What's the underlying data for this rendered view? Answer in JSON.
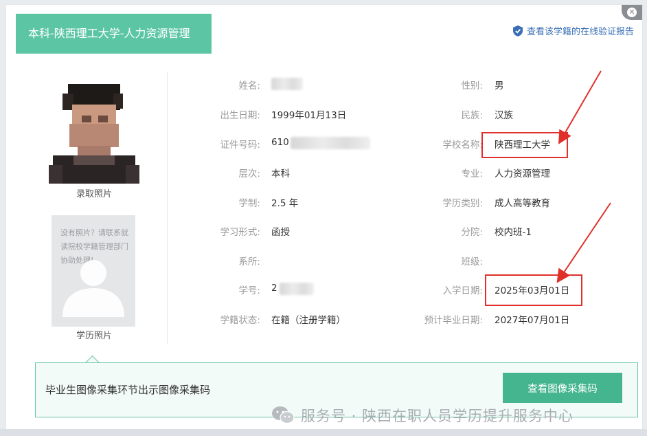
{
  "header": {
    "title": "本科-陕西理工大学-人力资源管理",
    "verify_link": "查看该学籍的在线验证报告"
  },
  "photos": {
    "enroll_label": "录取照片",
    "xueli_label": "学历照片",
    "xueli_placeholder_note": "没有照片？请联系就读院校学籍管理部门协助处理!"
  },
  "fields_left": [
    {
      "label": "姓名:",
      "value": ""
    },
    {
      "label": "出生日期:",
      "value": "1999年01月13日"
    },
    {
      "label": "证件号码:",
      "value": "610"
    },
    {
      "label": "层次:",
      "value": "本科"
    },
    {
      "label": "学制:",
      "value": "2.5 年"
    },
    {
      "label": "学习形式:",
      "value": "函授"
    },
    {
      "label": "系所:",
      "value": ""
    },
    {
      "label": "学号:",
      "value": "2"
    },
    {
      "label": "学籍状态:",
      "value": "在籍（注册学籍）"
    }
  ],
  "fields_right": [
    {
      "label": "性别:",
      "value": "男"
    },
    {
      "label": "民族:",
      "value": "汉族"
    },
    {
      "label": "学校名称:",
      "value": "陕西理工大学"
    },
    {
      "label": "专业:",
      "value": "人力资源管理"
    },
    {
      "label": "学历类别:",
      "value": "成人高等教育"
    },
    {
      "label": "分院:",
      "value": "校内班-1"
    },
    {
      "label": "班级:",
      "value": ""
    },
    {
      "label": "入学日期:",
      "value": "2025年03月01日"
    },
    {
      "label": "预计毕业日期:",
      "value": "2027年07月01日"
    }
  ],
  "notice": {
    "text": "毕业生图像采集环节出示图像采集码",
    "button": "查看图像采集码"
  },
  "watermark": "服务号 · 陕西在职人员学历提升服务中心",
  "colors": {
    "accent_green": "#5cc6a4",
    "button_green": "#44b58f",
    "highlight_red": "#e0302a",
    "link_blue": "#3a6fb5"
  },
  "icons": [
    "shield-icon",
    "close-icon",
    "person-silhouette-icon",
    "wechat-icon",
    "arrow-icon"
  ]
}
